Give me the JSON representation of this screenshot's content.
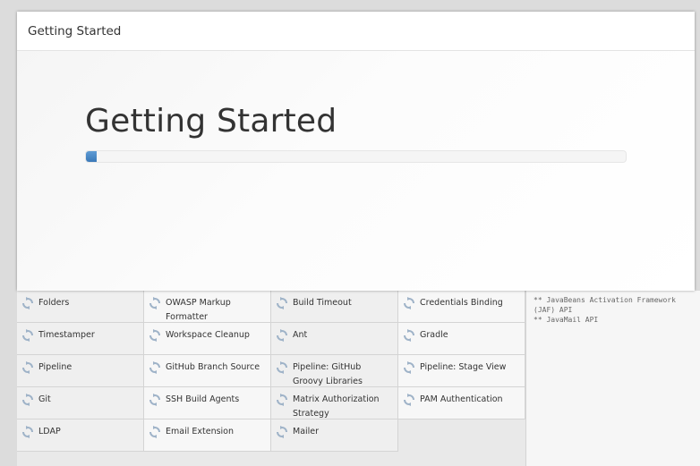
{
  "dialog": {
    "title": "Getting Started",
    "heading": "Getting Started",
    "progress_percent": 2
  },
  "plugins": [
    {
      "label": "Folders",
      "icon": "refresh-icon"
    },
    {
      "label": "OWASP Markup Formatter",
      "icon": "refresh-icon"
    },
    {
      "label": "Build Timeout",
      "icon": "refresh-icon"
    },
    {
      "label": "Credentials Binding",
      "icon": "refresh-icon"
    },
    {
      "label": "Timestamper",
      "icon": "refresh-icon"
    },
    {
      "label": "Workspace Cleanup",
      "icon": "refresh-icon"
    },
    {
      "label": "Ant",
      "icon": "refresh-icon"
    },
    {
      "label": "Gradle",
      "icon": "refresh-icon"
    },
    {
      "label": "Pipeline",
      "icon": "refresh-icon"
    },
    {
      "label": "GitHub Branch Source",
      "icon": "refresh-icon"
    },
    {
      "label": "Pipeline: GitHub Groovy Libraries",
      "icon": "refresh-icon"
    },
    {
      "label": "Pipeline: Stage View",
      "icon": "refresh-icon"
    },
    {
      "label": "Git",
      "icon": "refresh-icon"
    },
    {
      "label": "SSH Build Agents",
      "icon": "refresh-icon"
    },
    {
      "label": "Matrix Authorization Strategy",
      "icon": "refresh-icon"
    },
    {
      "label": "PAM Authentication",
      "icon": "refresh-icon"
    },
    {
      "label": "LDAP",
      "icon": "refresh-icon"
    },
    {
      "label": "Email Extension",
      "icon": "refresh-icon"
    },
    {
      "label": "Mailer",
      "icon": "refresh-icon"
    }
  ],
  "install_log": [
    "** JavaBeans Activation Framework (JAF) API",
    "** JavaMail API"
  ],
  "colors": {
    "progress": "#3a79b8",
    "icon": "#9fb3c8"
  }
}
